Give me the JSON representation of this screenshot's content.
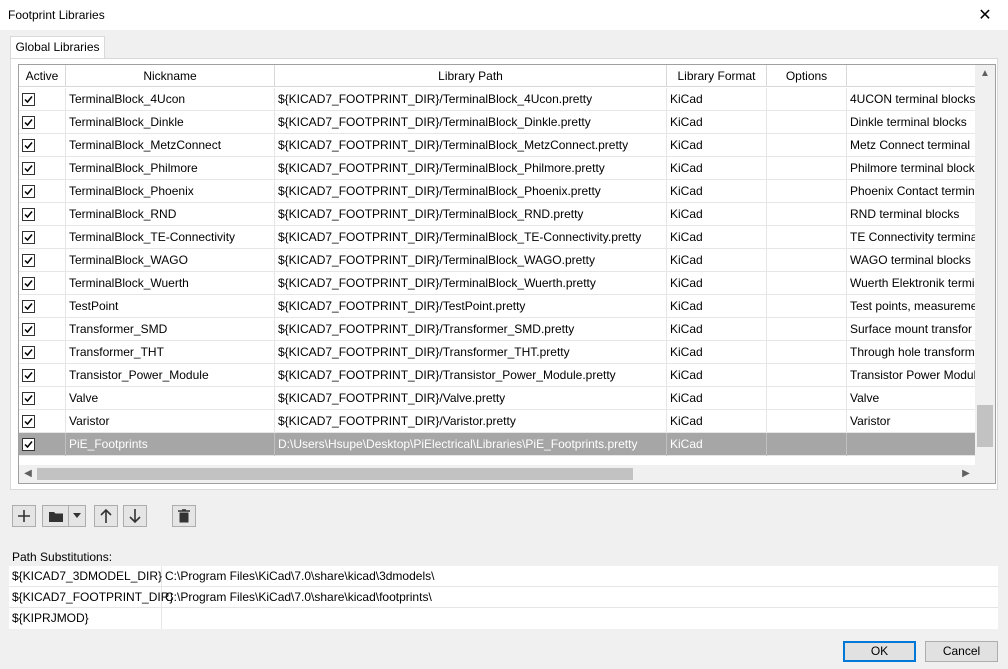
{
  "window": {
    "title": "Footprint Libraries",
    "close_glyph": "✕"
  },
  "tabs": [
    {
      "label": "Global Libraries"
    }
  ],
  "grid": {
    "columns": [
      "Active",
      "Nickname",
      "Library Path",
      "Library Format",
      "Options",
      ""
    ],
    "rows": [
      {
        "active": true,
        "nickname": "TerminalBlock_4Ucon",
        "path": "${KICAD7_FOOTPRINT_DIR}/TerminalBlock_4Ucon.pretty",
        "format": "KiCad",
        "options": "",
        "description": "4UCON terminal blocks"
      },
      {
        "active": true,
        "nickname": "TerminalBlock_Dinkle",
        "path": "${KICAD7_FOOTPRINT_DIR}/TerminalBlock_Dinkle.pretty",
        "format": "KiCad",
        "options": "",
        "description": "Dinkle terminal blocks"
      },
      {
        "active": true,
        "nickname": "TerminalBlock_MetzConnect",
        "path": "${KICAD7_FOOTPRINT_DIR}/TerminalBlock_MetzConnect.pretty",
        "format": "KiCad",
        "options": "",
        "description": "Metz Connect terminal"
      },
      {
        "active": true,
        "nickname": "TerminalBlock_Philmore",
        "path": "${KICAD7_FOOTPRINT_DIR}/TerminalBlock_Philmore.pretty",
        "format": "KiCad",
        "options": "",
        "description": "Philmore terminal block"
      },
      {
        "active": true,
        "nickname": "TerminalBlock_Phoenix",
        "path": "${KICAD7_FOOTPRINT_DIR}/TerminalBlock_Phoenix.pretty",
        "format": "KiCad",
        "options": "",
        "description": "Phoenix Contact termin"
      },
      {
        "active": true,
        "nickname": "TerminalBlock_RND",
        "path": "${KICAD7_FOOTPRINT_DIR}/TerminalBlock_RND.pretty",
        "format": "KiCad",
        "options": "",
        "description": "RND terminal blocks"
      },
      {
        "active": true,
        "nickname": "TerminalBlock_TE-Connectivity",
        "path": "${KICAD7_FOOTPRINT_DIR}/TerminalBlock_TE-Connectivity.pretty",
        "format": "KiCad",
        "options": "",
        "description": "TE Connectivity termina"
      },
      {
        "active": true,
        "nickname": "TerminalBlock_WAGO",
        "path": "${KICAD7_FOOTPRINT_DIR}/TerminalBlock_WAGO.pretty",
        "format": "KiCad",
        "options": "",
        "description": "WAGO terminal blocks"
      },
      {
        "active": true,
        "nickname": "TerminalBlock_Wuerth",
        "path": "${KICAD7_FOOTPRINT_DIR}/TerminalBlock_Wuerth.pretty",
        "format": "KiCad",
        "options": "",
        "description": "Wuerth Elektronik termi"
      },
      {
        "active": true,
        "nickname": "TestPoint",
        "path": "${KICAD7_FOOTPRINT_DIR}/TestPoint.pretty",
        "format": "KiCad",
        "options": "",
        "description": "Test points, measureme"
      },
      {
        "active": true,
        "nickname": "Transformer_SMD",
        "path": "${KICAD7_FOOTPRINT_DIR}/Transformer_SMD.pretty",
        "format": "KiCad",
        "options": "",
        "description": "Surface mount transfor"
      },
      {
        "active": true,
        "nickname": "Transformer_THT",
        "path": "${KICAD7_FOOTPRINT_DIR}/Transformer_THT.pretty",
        "format": "KiCad",
        "options": "",
        "description": "Through hole transform"
      },
      {
        "active": true,
        "nickname": "Transistor_Power_Module",
        "path": "${KICAD7_FOOTPRINT_DIR}/Transistor_Power_Module.pretty",
        "format": "KiCad",
        "options": "",
        "description": "Transistor Power Modul"
      },
      {
        "active": true,
        "nickname": "Valve",
        "path": "${KICAD7_FOOTPRINT_DIR}/Valve.pretty",
        "format": "KiCad",
        "options": "",
        "description": "Valve"
      },
      {
        "active": true,
        "nickname": "Varistor",
        "path": "${KICAD7_FOOTPRINT_DIR}/Varistor.pretty",
        "format": "KiCad",
        "options": "",
        "description": "Varistor"
      },
      {
        "active": true,
        "nickname": "PiE_Footprints",
        "path": "D:\\Users\\Hsupe\\Desktop\\PiElectrical\\Libraries\\PiE_Footprints.pretty",
        "format": "KiCad",
        "options": "",
        "description": "",
        "selected": true
      }
    ]
  },
  "toolbar": {
    "add_icon": "plus-icon",
    "folder_icon": "folder-icon",
    "dropdown_icon": "chevron-down-icon",
    "up_icon": "arrow-up-icon",
    "down_icon": "arrow-down-icon",
    "delete_icon": "trash-icon"
  },
  "path_substitutions": {
    "label": "Path Substitutions:",
    "rows": [
      {
        "name": "${KICAD7_3DMODEL_DIR}",
        "value": "C:\\Program Files\\KiCad\\7.0\\share\\kicad\\3dmodels\\"
      },
      {
        "name": "${KICAD7_FOOTPRINT_DIR}",
        "value": "C:\\Program Files\\KiCad\\7.0\\share\\kicad\\footprints\\"
      },
      {
        "name": "${KIPRJMOD}",
        "value": ""
      }
    ]
  },
  "buttons": {
    "ok": "OK",
    "cancel": "Cancel"
  }
}
